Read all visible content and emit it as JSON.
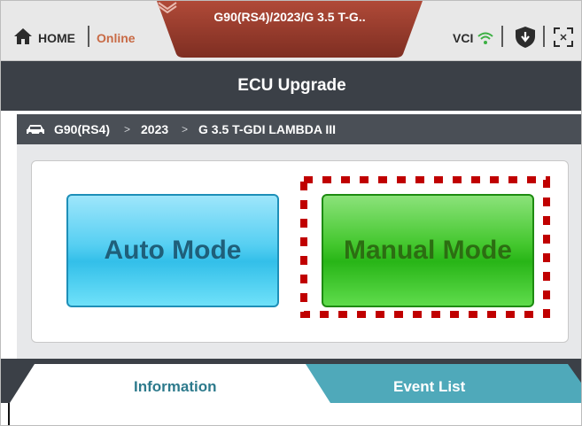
{
  "topbar": {
    "home_label": "HOME",
    "status_label": "Online",
    "vehicle_title": "G90(RS4)/2023/G 3.5 T-G..",
    "vci_label": "VCI"
  },
  "header": {
    "title": "ECU Upgrade"
  },
  "breadcrumb": {
    "items": [
      "G90(RS4)",
      "2023",
      "G 3.5 T-GDI LAMBDA III"
    ],
    "separator": ">"
  },
  "modes": {
    "auto_label": "Auto Mode",
    "manual_label": "Manual Mode"
  },
  "tabs": {
    "items": [
      {
        "label": "Information"
      },
      {
        "label": "Event List"
      }
    ]
  },
  "colors": {
    "status_online": "#c86a45",
    "vehicle_tab": "#9c3d2f",
    "title_bar": "#3b4047",
    "highlight": "#c00000",
    "auto_button": "#33bfe9",
    "manual_button": "#28b517",
    "tab_active_text": "#2d7a8c",
    "tab_inactive_bg": "#4fa9ba"
  },
  "icons": [
    "home-icon",
    "chevron-down-icon",
    "vci-signal-icon",
    "shield-icon",
    "fullscreen-icon",
    "car-icon"
  ]
}
